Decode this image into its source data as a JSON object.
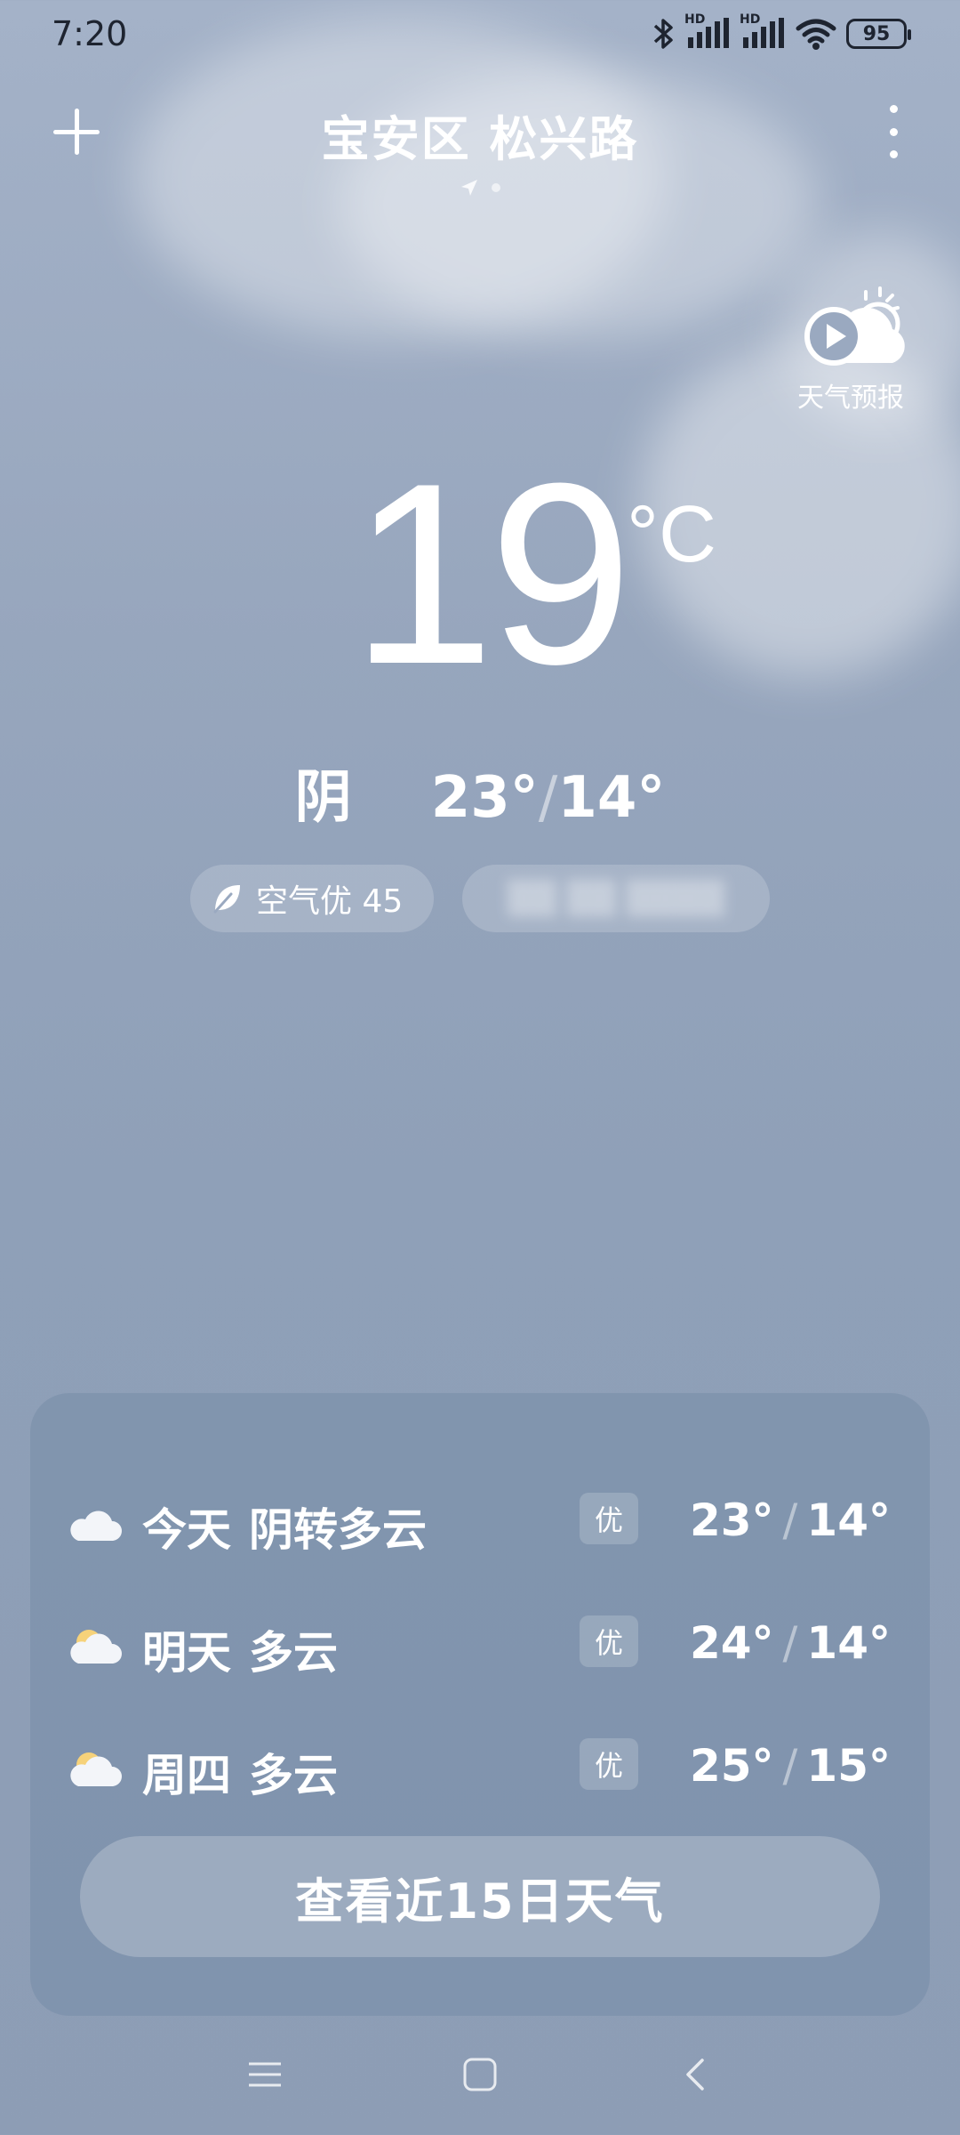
{
  "status_bar": {
    "time": "7:20",
    "battery": "95",
    "signal1_label": "HD",
    "signal2_label": "HD"
  },
  "header": {
    "location": "宝安区 松兴路",
    "add_icon": "plus-icon",
    "more_icon": "more-vertical-icon"
  },
  "forecast_video": {
    "label": "天气预报",
    "icon": "play-sun-cloud-icon"
  },
  "current": {
    "temperature": "19",
    "unit": "°C",
    "condition": "阴",
    "high": "23°",
    "low": "14°",
    "separator": "/"
  },
  "aqi_pill": {
    "label": "空气优 45",
    "icon": "leaf-icon"
  },
  "blurred_pill": {
    "text": ""
  },
  "forecast": {
    "days": [
      {
        "day": "今天",
        "condition": "阴转多云",
        "aqi": "优",
        "high": "23°",
        "low": "14°",
        "icon": "cloud-icon"
      },
      {
        "day": "明天",
        "condition": "多云",
        "aqi": "优",
        "high": "24°",
        "low": "14°",
        "icon": "sun-cloud-icon"
      },
      {
        "day": "周四",
        "condition": "多云",
        "aqi": "优",
        "high": "25°",
        "low": "15°",
        "icon": "sun-cloud-icon"
      }
    ],
    "separator": "/",
    "button_label": "查看近15日天气"
  },
  "colors": {
    "background_top": "#a4b2c8",
    "background_bottom": "#8d9db5",
    "text": "#ffffff",
    "status_text": "#1e2430"
  }
}
